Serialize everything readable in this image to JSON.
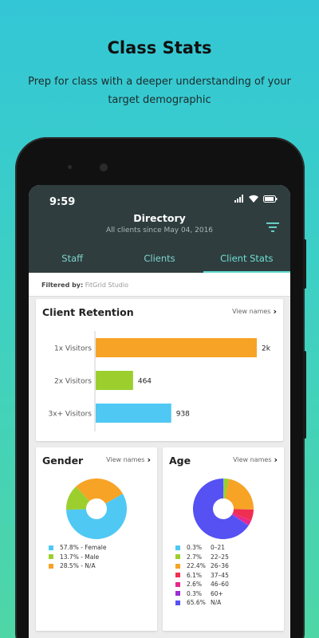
{
  "promo": {
    "title": "Class Stats",
    "subtitle": "Prep for class with a deeper understanding of your target demographic"
  },
  "status_bar": {
    "time": "9:59"
  },
  "header": {
    "title": "Directory",
    "subtitle": "All clients since May 04, 2016"
  },
  "tabs": [
    {
      "label": "Staff",
      "active": false
    },
    {
      "label": "Clients",
      "active": false
    },
    {
      "label": "Client Stats",
      "active": true
    }
  ],
  "filter": {
    "label": "Filtered by:",
    "value": "FitGrid Studio"
  },
  "retention": {
    "title": "Client Retention",
    "view_names": "View names",
    "bars": [
      {
        "label": "1x Visitors",
        "value": 2000,
        "display": "2k",
        "color": "#f7a325"
      },
      {
        "label": "2x Visitors",
        "value": 464,
        "display": "464",
        "color": "#9ccf2e"
      },
      {
        "label": "3x+ Visitors",
        "value": 938,
        "display": "938",
        "color": "#4fc8f4"
      }
    ]
  },
  "gender": {
    "title": "Gender",
    "view_names": "View names",
    "legend": [
      {
        "pct": "57.8%",
        "label": "- Female",
        "value": 57.8,
        "color": "#4fc8f4"
      },
      {
        "pct": "13.7%",
        "label": "- Male",
        "value": 13.7,
        "color": "#9ccf2e"
      },
      {
        "pct": "28.5%",
        "label": "- N/A",
        "value": 28.5,
        "color": "#f7a325"
      }
    ]
  },
  "age": {
    "title": "Age",
    "view_names": "View names",
    "legend": [
      {
        "pct": "0.3%",
        "label": "0–21",
        "value": 0.3,
        "color": "#4fc8f4"
      },
      {
        "pct": "2.7%",
        "label": "22–25",
        "value": 2.7,
        "color": "#9ccf2e"
      },
      {
        "pct": "22.4%",
        "label": "26–36",
        "value": 22.4,
        "color": "#f7a325"
      },
      {
        "pct": "6.1%",
        "label": "37–45",
        "value": 6.1,
        "color": "#ef2f52"
      },
      {
        "pct": "2.6%",
        "label": "46–60",
        "value": 2.6,
        "color": "#e5298c"
      },
      {
        "pct": "0.3%",
        "label": "60+",
        "value": 0.3,
        "color": "#9b2ed6"
      },
      {
        "pct": "65.6%",
        "label": "N/A",
        "value": 65.6,
        "color": "#5551f3"
      }
    ]
  },
  "colors": {
    "header_bg": "#2f3d3e",
    "tab_accent": "#5fd8d0"
  },
  "icons": [
    "signal-icon",
    "wifi-icon",
    "battery-icon",
    "filter-icon",
    "chevron-right-icon"
  ]
}
